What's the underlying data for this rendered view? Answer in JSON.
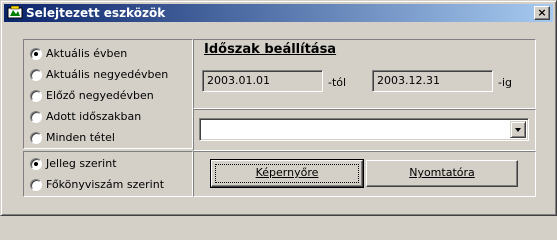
{
  "window": {
    "title": "Selejtezett eszközök",
    "close_glyph": "×"
  },
  "period_options": [
    {
      "label": "Aktuális évben",
      "selected": true
    },
    {
      "label": "Aktuális negyedévben",
      "selected": false
    },
    {
      "label": "Előző negyedévben",
      "selected": false
    },
    {
      "label": "Adott időszakban",
      "selected": false
    },
    {
      "label": "Minden tétel",
      "selected": false
    }
  ],
  "grouping_options": [
    {
      "label": "Jelleg szerint",
      "selected": true
    },
    {
      "label": "Főkönyviszám szerint",
      "selected": false
    }
  ],
  "period_settings": {
    "header": "Időszak beállítása",
    "from_value": "2003.01.01",
    "from_suffix": "-tól",
    "to_value": "2003.12.31",
    "to_suffix": "-ig"
  },
  "filter_combo": {
    "value": ""
  },
  "actions": {
    "screen_label": "Képernyőre",
    "printer_label": "Nyomtatóra"
  },
  "colors": {
    "face": "#d4d0c8",
    "titlebar_start": "#0a246a",
    "titlebar_end": "#a6caf0"
  }
}
